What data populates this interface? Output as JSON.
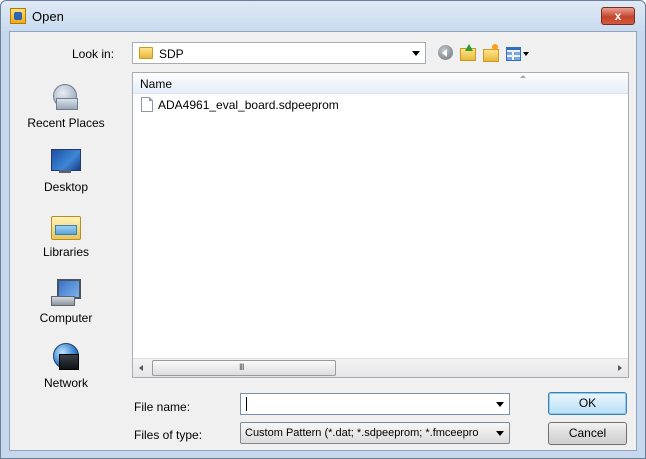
{
  "window": {
    "title": "Open",
    "close_label": "x"
  },
  "toolbar": {
    "look_in_label": "Look in:",
    "look_in_value": "SDP"
  },
  "places": [
    {
      "label": "Recent Places",
      "icon": "recent-places-icon"
    },
    {
      "label": "Desktop",
      "icon": "desktop-icon"
    },
    {
      "label": "Libraries",
      "icon": "libraries-icon"
    },
    {
      "label": "Computer",
      "icon": "computer-icon"
    },
    {
      "label": "Network",
      "icon": "network-icon"
    }
  ],
  "file_list": {
    "column_header": "Name",
    "files": [
      {
        "name": "ADA4961_eval_board.sdpeeprom",
        "icon": "document-icon"
      }
    ],
    "scroll_grip": "III"
  },
  "form": {
    "file_name_label": "File name:",
    "file_name_value": "",
    "files_of_type_label": "Files of type:",
    "files_of_type_value": "Custom Pattern (*.dat; *.sdpeeprom; *.fmceepro"
  },
  "buttons": {
    "ok": "OK",
    "cancel": "Cancel"
  },
  "colors": {
    "frame": "#c7d8ec",
    "client": "#f0f0f0",
    "accent": "#3c7fb1"
  }
}
